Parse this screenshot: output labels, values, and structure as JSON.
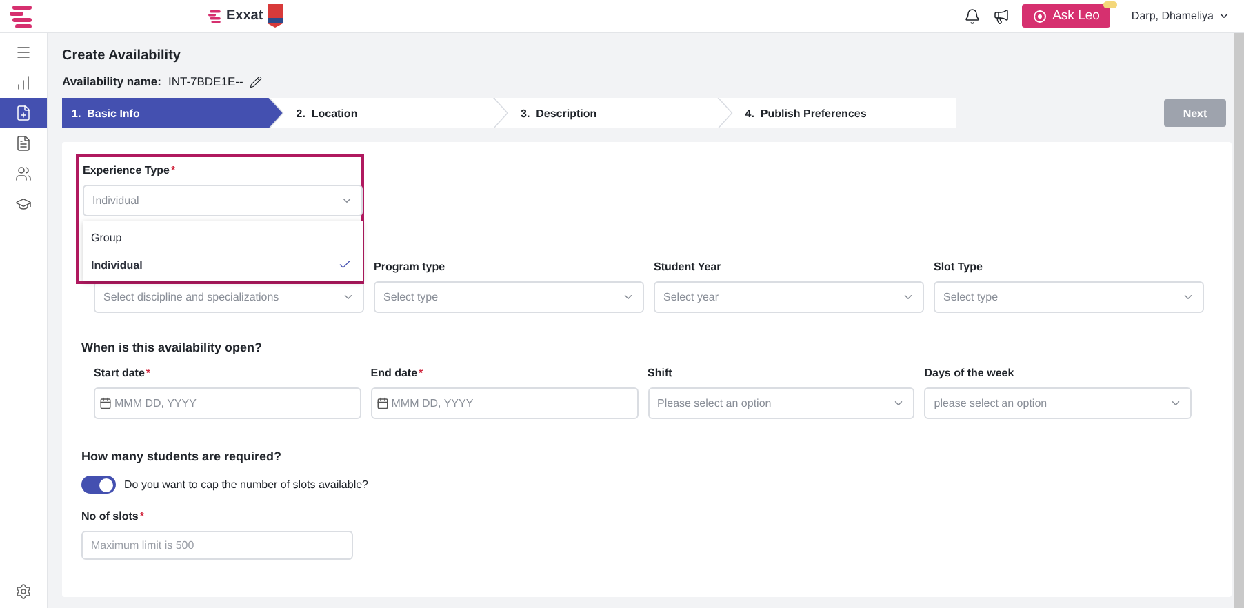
{
  "topbar": {
    "brand": "Exxat",
    "ask_button": "Ask Leo",
    "user": "Darp, Dhameliya"
  },
  "sidebar": {
    "items": [
      {
        "selected": false
      },
      {
        "selected": false
      },
      {
        "selected": true
      },
      {
        "selected": false
      },
      {
        "selected": false
      },
      {
        "selected": false
      }
    ]
  },
  "page": {
    "title": "Create Availability",
    "name_label": "Availability name:",
    "name_value": "INT-7BDE1E--"
  },
  "steps": [
    {
      "label": "1.  Basic Info",
      "selected": true
    },
    {
      "label": "2.  Location",
      "selected": false
    },
    {
      "label": "3.  Description",
      "selected": false
    },
    {
      "label": "4.  Publish Preferences",
      "selected": false
    }
  ],
  "next_button": {
    "label": "Next",
    "disabled": true
  },
  "experience_type": {
    "label": "Experience Type",
    "required_mark": "*",
    "value": "Individual",
    "expanded": true,
    "options": [
      {
        "label": "Group",
        "selected": false
      },
      {
        "label": "Individual",
        "selected": true
      }
    ]
  },
  "program_fields": [
    {
      "placeholder": "Select discipline and specializations"
    },
    {
      "label": "Program type",
      "placeholder": "Select type"
    },
    {
      "label": "Student Year",
      "placeholder": "Select year"
    },
    {
      "label": "Slot Type",
      "placeholder": "Select type"
    }
  ],
  "availability": {
    "heading": "When is this availability open?",
    "fields": [
      {
        "label": "Start date",
        "required_mark": "*",
        "kind": "date",
        "placeholder": "MMM DD, YYYY"
      },
      {
        "label": "End date",
        "required_mark": "*",
        "kind": "date",
        "placeholder": "MMM DD, YYYY"
      },
      {
        "label": "Shift",
        "kind": "select",
        "placeholder": "Please select an option"
      },
      {
        "label": "Days of the week",
        "kind": "select",
        "placeholder": "please select an option"
      }
    ]
  },
  "students": {
    "heading": "How many students are required?",
    "toggle": {
      "label": "Do you want to cap the number of slots available?",
      "on": true
    },
    "slots": {
      "label": "No of slots",
      "required_mark": "*",
      "placeholder": "Maximum limit is 500"
    }
  }
}
